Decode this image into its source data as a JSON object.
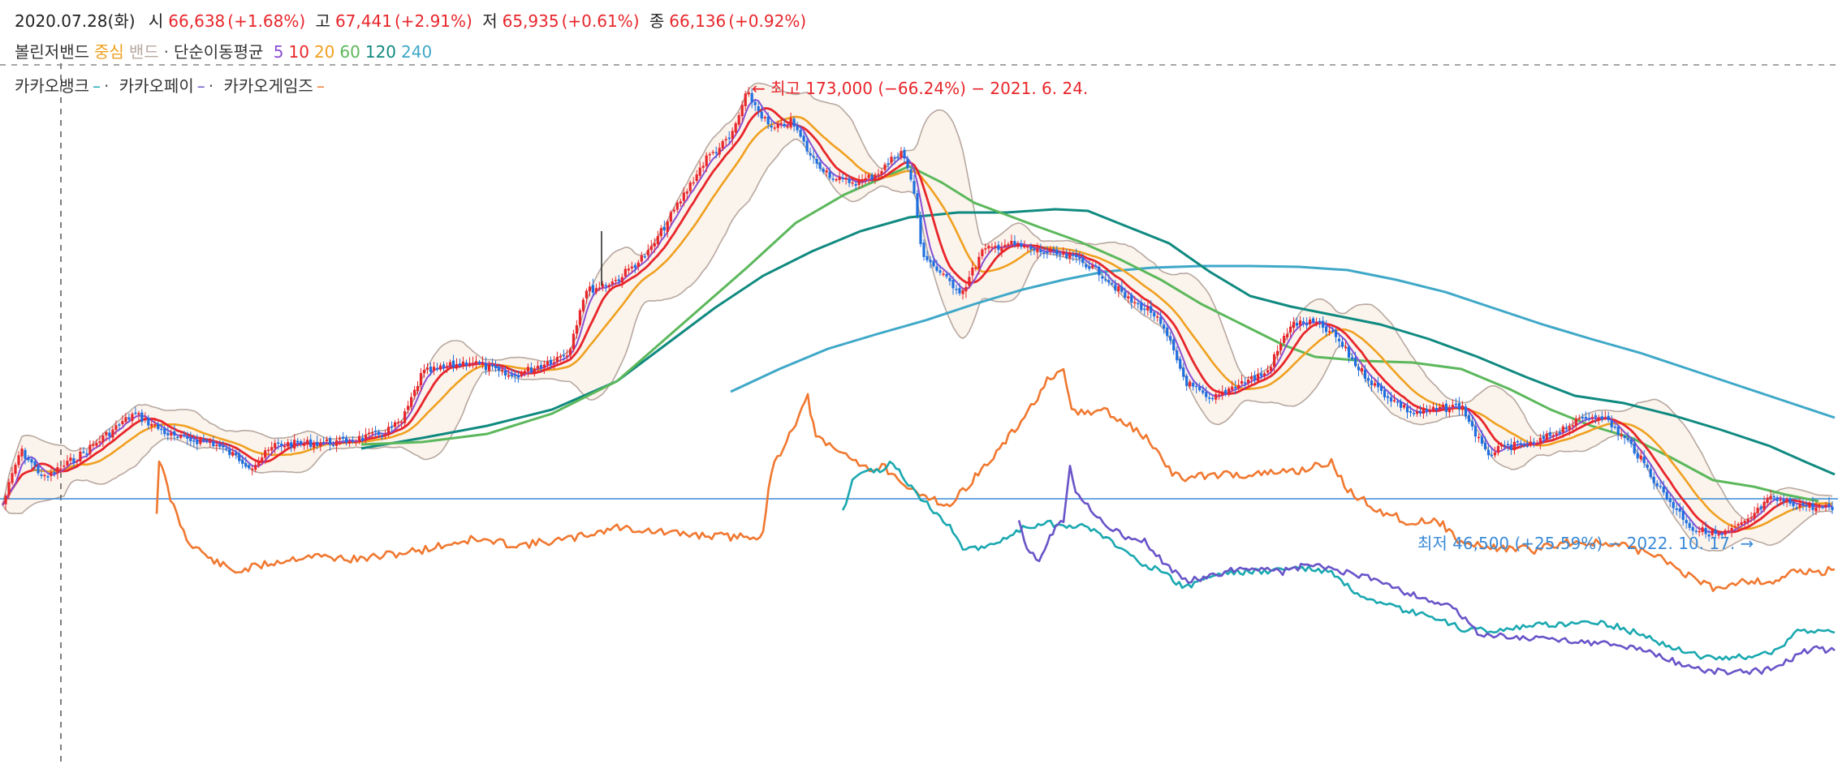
{
  "ohlc_header": {
    "date": "2020.07.28(화)",
    "open_label": "시",
    "open_value": "66,638",
    "open_change": "(+1.68%)",
    "high_label": "고",
    "high_value": "67,441",
    "high_change": "(+2.91%)",
    "low_label": "저",
    "low_value": "65,935",
    "low_change": "(+0.61%)",
    "close_label": "종",
    "close_value": "66,136",
    "close_change": "(+0.92%)"
  },
  "indicators": {
    "bollinger_label": "볼린저밴드",
    "bollinger_center": "중심",
    "bollinger_band": "밴드",
    "sma_label": "단순이동평균",
    "periods": [
      "5",
      "10",
      "20",
      "60",
      "120",
      "240"
    ]
  },
  "compare": {
    "items": [
      {
        "name": "카카오뱅크",
        "marker": "–"
      },
      {
        "name": "카카오페이",
        "marker": "–"
      },
      {
        "name": "카카오게임즈",
        "marker": "–"
      }
    ],
    "separator": "·"
  },
  "annotations": {
    "high": "← 최고 173,000 (−66.24%) − 2021. 6. 24.",
    "low": "최저 46,500 (+25.59%) − 2022. 10. 17. →"
  },
  "colors": {
    "up": "#e8262b",
    "down": "#1f6fe0",
    "ma5": "#8b4fd3",
    "ma10": "#e8262b",
    "ma20": "#f0a020",
    "ma60": "#5cb85c",
    "ma120": "#108a80",
    "ma240": "#3fa8c8",
    "bollinger_center": "#f0a020",
    "bollinger_band": "#b8a8a0",
    "bollinger_fill": "#fbf4ec",
    "kakaobank": "#1aa8b0",
    "kakaopay": "#6a54c8",
    "kakaogames": "#f07830",
    "crosshair": "#555555",
    "baseline": "#3a8ad8"
  },
  "chart_data": {
    "type": "line",
    "x_start": "2020.07.28",
    "price_keypoints": [
      {
        "x": "2020.07",
        "y": 62000
      },
      {
        "x": "2020.08",
        "y": 80000
      },
      {
        "x": "2020.10",
        "y": 76000
      },
      {
        "x": "2020.12",
        "y": 78000
      },
      {
        "x": "2021.02",
        "y": 100000
      },
      {
        "x": "2021.04",
        "y": 118000
      },
      {
        "x": "2021.06",
        "y": 173000
      },
      {
        "x": "2021.07",
        "y": 150000
      },
      {
        "x": "2021.09",
        "y": 125000
      },
      {
        "x": "2021.11",
        "y": 128000
      },
      {
        "x": "2022.01",
        "y": 110000
      },
      {
        "x": "2022.03",
        "y": 102000
      },
      {
        "x": "2022.05",
        "y": 82000
      },
      {
        "x": "2022.07",
        "y": 78000
      },
      {
        "x": "2022.09",
        "y": 68000
      },
      {
        "x": "2022.10",
        "y": 46500
      },
      {
        "x": "2022.12",
        "y": 57000
      }
    ],
    "series": [
      {
        "name": "카카오뱅크"
      },
      {
        "name": "카카오페이"
      },
      {
        "name": "카카오게임즈"
      }
    ],
    "high": 173000,
    "low": 46500,
    "grid": false
  }
}
